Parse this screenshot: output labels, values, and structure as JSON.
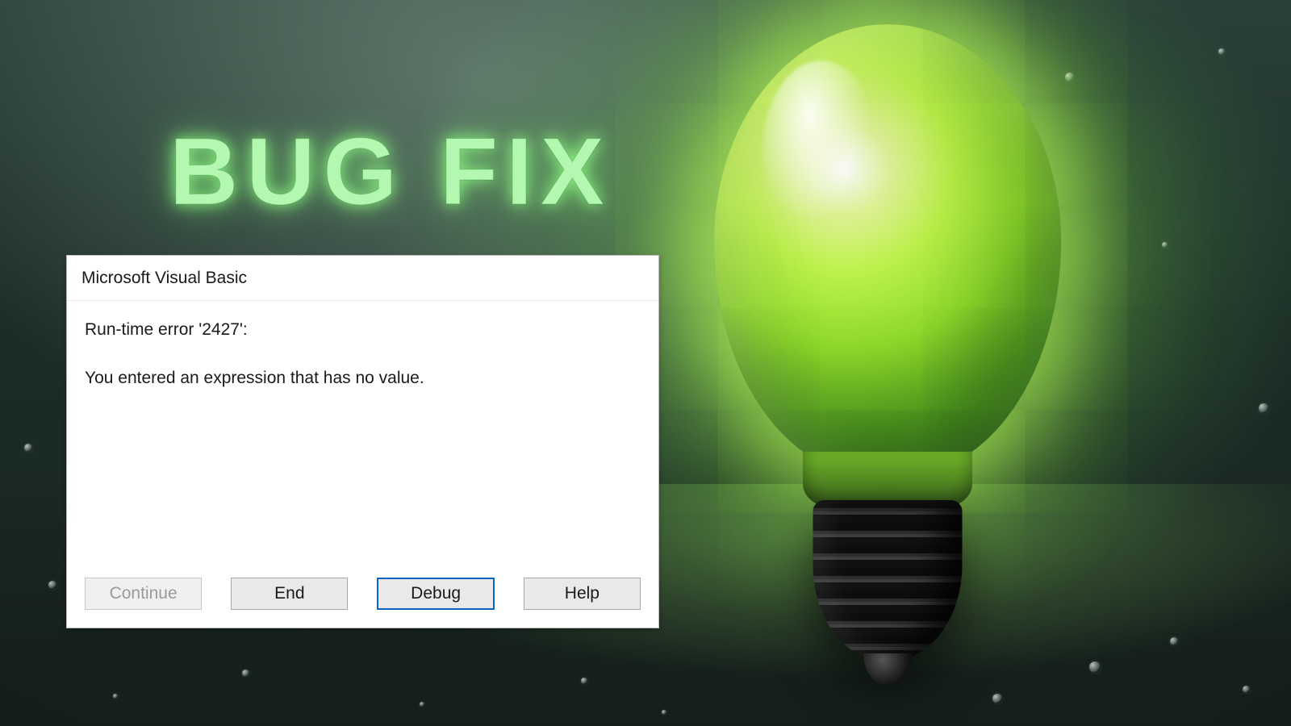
{
  "headline": "BUG FIX",
  "dialog": {
    "title": "Microsoft Visual Basic",
    "error_line": "Run-time error '2427':",
    "error_message": "You entered an expression that has no value.",
    "buttons": {
      "continue": "Continue",
      "end": "End",
      "debug": "Debug",
      "help": "Help"
    },
    "continue_enabled": false,
    "default_button": "debug"
  },
  "graphic": {
    "object": "light-bulb",
    "glow_color": "#b8ff4a"
  }
}
